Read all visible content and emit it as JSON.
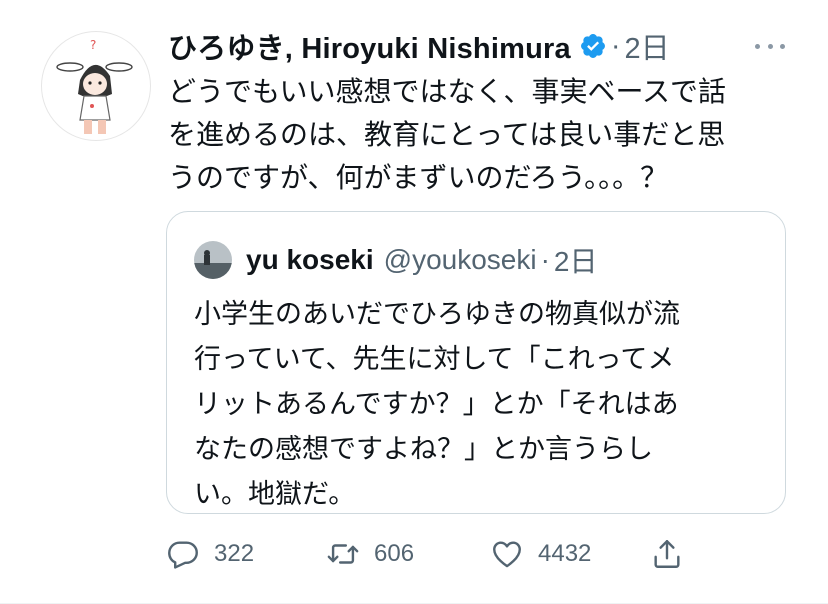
{
  "tweet": {
    "author_name": "ひろゆき, Hiroyuki Nishimura",
    "separator": "·",
    "time": "2日",
    "text": "どうでもいい感想ではなく、事実ベースで話\nを進めるのは、教育にとっては良い事だと思\nうのですが、何がまずいのだろう。。。？",
    "verified_icon": "verified-badge-icon",
    "verified_color": "#1d9bf0"
  },
  "quote": {
    "author_name": "yu koseki",
    "handle": "@youkoseki",
    "separator": "·",
    "time": "2日",
    "text": "小学生のあいだでひろゆきの物真似が流\n行っていて、先生に対して「これってメ\nリットあるんですか？」とか「それはあ\nなたの感想ですよね？」とか言うらし\nい。地獄だ。"
  },
  "actions": {
    "reply_count": "322",
    "retweet_count": "606",
    "like_count": "4432",
    "icons": [
      "reply-icon",
      "retweet-icon",
      "like-icon",
      "share-icon"
    ]
  }
}
